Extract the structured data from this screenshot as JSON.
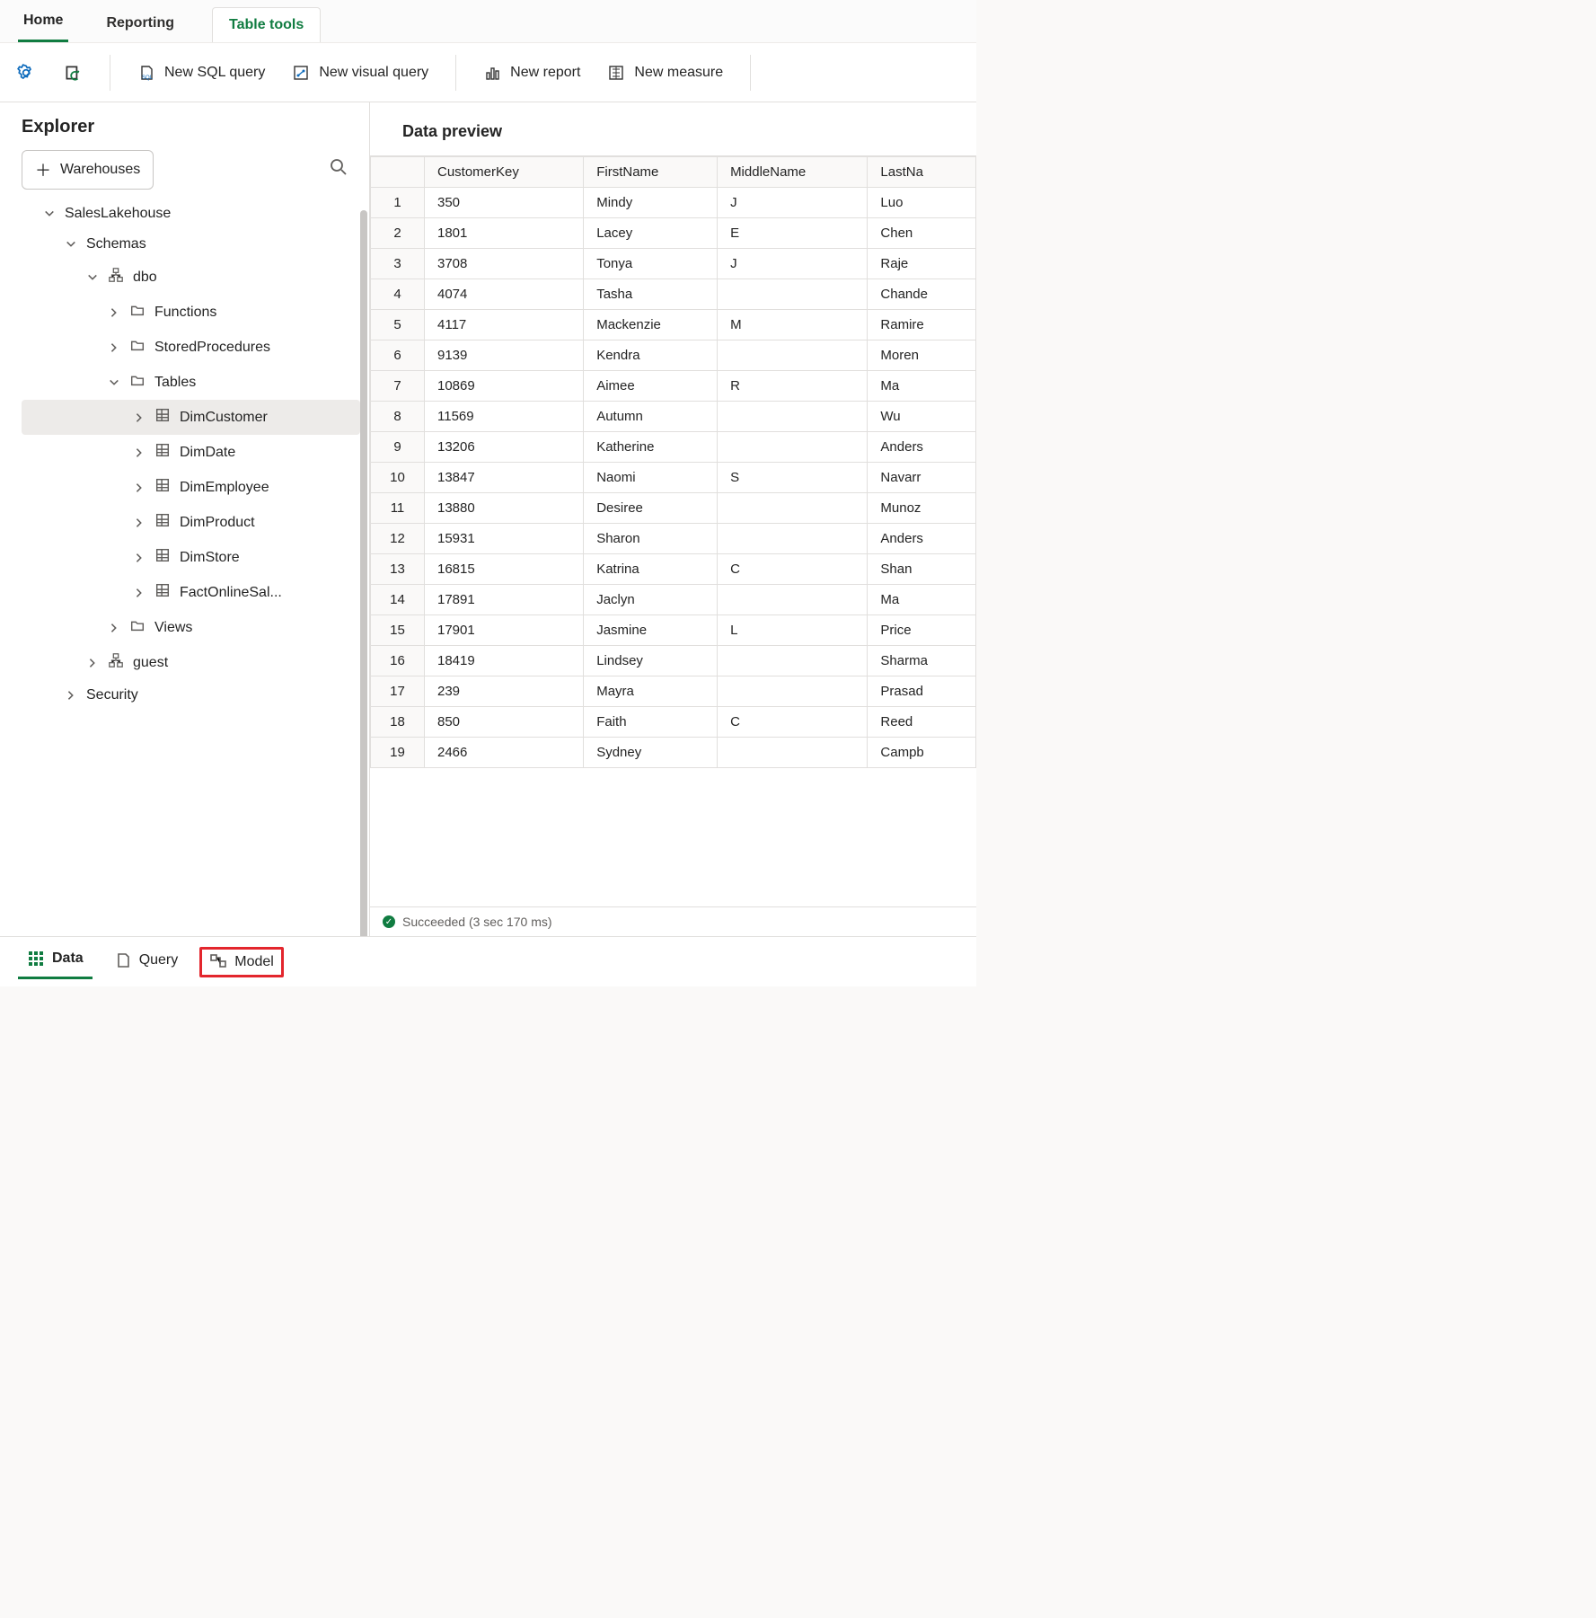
{
  "top_tabs": {
    "home": "Home",
    "reporting": "Reporting",
    "table_tools": "Table tools"
  },
  "toolbar": {
    "new_sql": "New SQL query",
    "new_visual": "New visual query",
    "new_report": "New report",
    "new_measure": "New measure"
  },
  "explorer": {
    "title": "Explorer",
    "warehouses_btn": "Warehouses",
    "root": "SalesLakehouse",
    "schemas": "Schemas",
    "dbo": "dbo",
    "functions": "Functions",
    "sp": "StoredProcedures",
    "tables": "Tables",
    "tables_list": [
      "DimCustomer",
      "DimDate",
      "DimEmployee",
      "DimProduct",
      "DimStore",
      "FactOnlineSal..."
    ],
    "views": "Views",
    "guest": "guest",
    "security": "Security"
  },
  "preview": {
    "title": "Data preview",
    "columns": [
      "CustomerKey",
      "FirstName",
      "MiddleName",
      "LastNa"
    ],
    "rows": [
      [
        "350",
        "Mindy",
        "J",
        "Luo"
      ],
      [
        "1801",
        "Lacey",
        "E",
        "Chen"
      ],
      [
        "3708",
        "Tonya",
        "J",
        "Raje"
      ],
      [
        "4074",
        "Tasha",
        "",
        "Chande"
      ],
      [
        "4117",
        "Mackenzie",
        "M",
        "Ramire"
      ],
      [
        "9139",
        "Kendra",
        "",
        "Moren"
      ],
      [
        "10869",
        "Aimee",
        "R",
        "Ma"
      ],
      [
        "11569",
        "Autumn",
        "",
        "Wu"
      ],
      [
        "13206",
        "Katherine",
        "",
        "Anders"
      ],
      [
        "13847",
        "Naomi",
        "S",
        "Navarr"
      ],
      [
        "13880",
        "Desiree",
        "",
        "Munoz"
      ],
      [
        "15931",
        "Sharon",
        "",
        "Anders"
      ],
      [
        "16815",
        "Katrina",
        "C",
        "Shan"
      ],
      [
        "17891",
        "Jaclyn",
        "",
        "Ma"
      ],
      [
        "17901",
        "Jasmine",
        "L",
        "Price"
      ],
      [
        "18419",
        "Lindsey",
        "",
        "Sharma"
      ],
      [
        "239",
        "Mayra",
        "",
        "Prasad"
      ],
      [
        "850",
        "Faith",
        "C",
        "Reed"
      ],
      [
        "2466",
        "Sydney",
        "",
        "Campb"
      ]
    ],
    "status": "Succeeded (3 sec 170 ms)"
  },
  "bottom": {
    "data": "Data",
    "query": "Query",
    "model": "Model"
  }
}
